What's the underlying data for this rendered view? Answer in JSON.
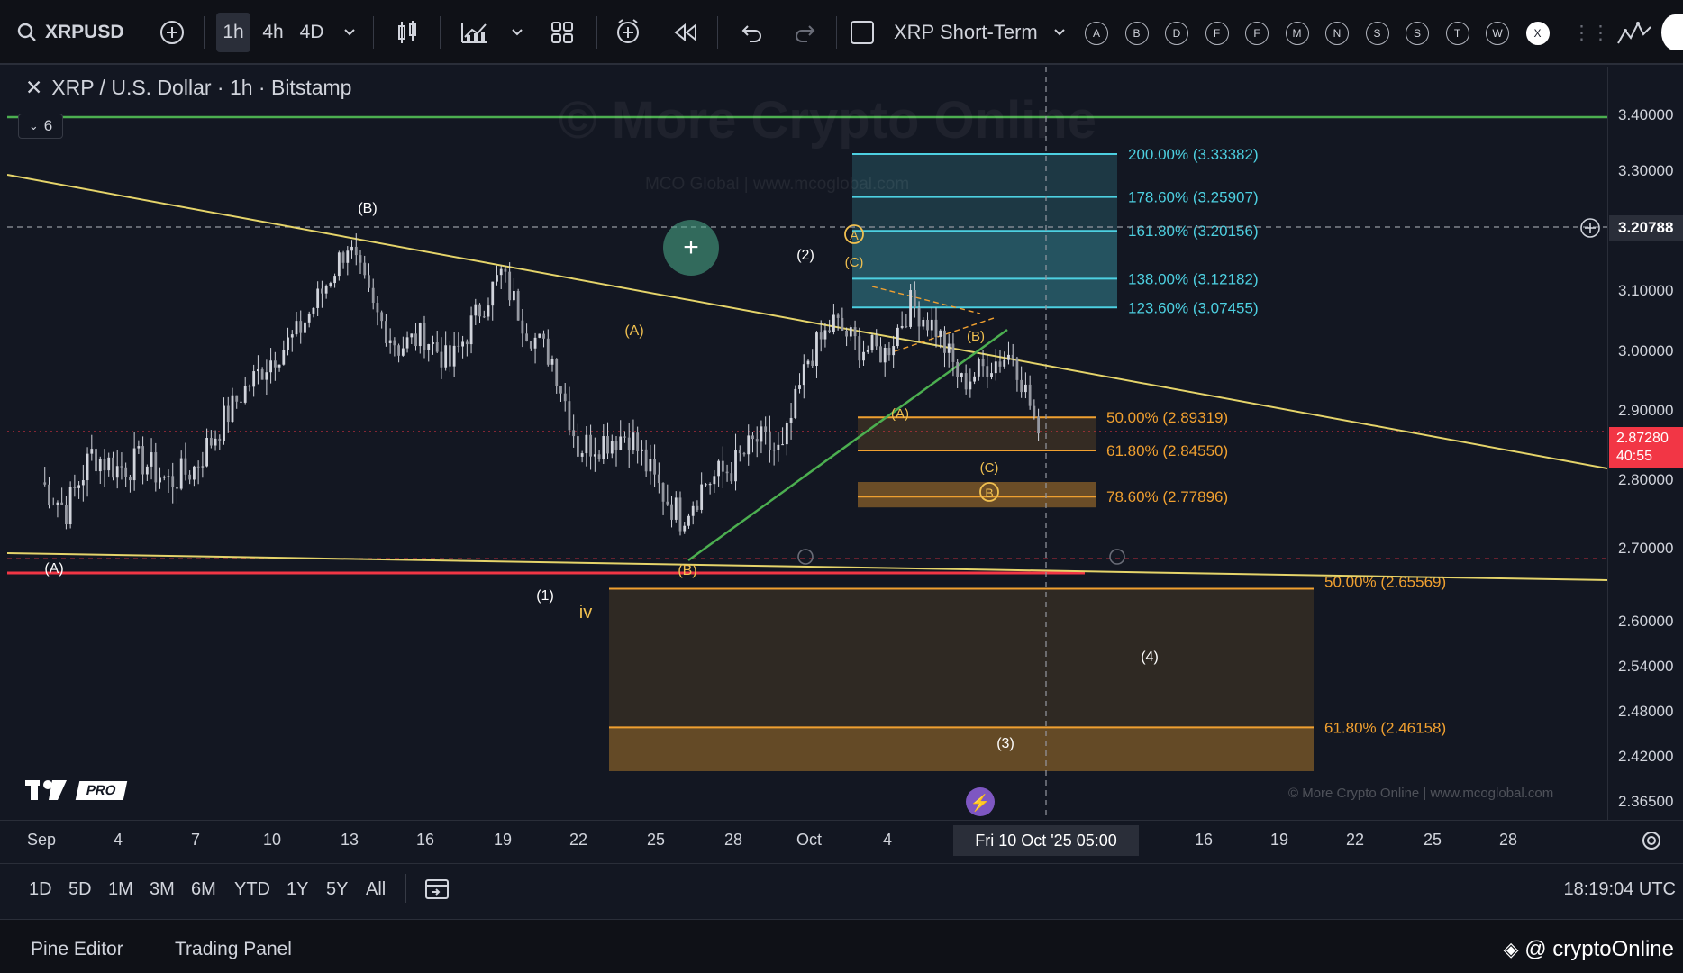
{
  "toolbar": {
    "symbol": "XRPUSD",
    "intervals": [
      "1h",
      "4h",
      "4D"
    ],
    "layout_name": "XRP Short-Term",
    "letter_buttons": [
      "A",
      "B",
      "D",
      "F",
      "F",
      "M",
      "N",
      "S",
      "S",
      "T",
      "W",
      "X"
    ]
  },
  "chart_header": {
    "title": "XRP / U.S. Dollar · 1h · Bitstamp",
    "collapse_count": "6",
    "watermark": "© More Crypto Online",
    "watermark_sub": "MCO Global  |  www.mcoglobal.com",
    "footer_watermark": "© More Crypto Online  |  www.mcoglobal.com",
    "logo_badge": "PRO"
  },
  "price_axis": {
    "ticks": [
      "3.40000",
      "3.30000",
      "3.20788",
      "3.10000",
      "3.00000",
      "2.90000",
      "2.80000",
      "2.70000",
      "2.60000",
      "2.54000",
      "2.48000",
      "2.42000",
      "2.36500"
    ],
    "crosshair_price": "3.20788",
    "last_price": "2.87280",
    "countdown": "40:55"
  },
  "time_axis": {
    "ticks": [
      "Sep",
      "4",
      "7",
      "10",
      "13",
      "16",
      "19",
      "22",
      "25",
      "28",
      "Oct",
      "4",
      "16",
      "19",
      "22",
      "25",
      "28"
    ],
    "cursor_label": "Fri 10 Oct '25   05:00"
  },
  "range_bar": {
    "ranges": [
      "1D",
      "5D",
      "1M",
      "3M",
      "6M",
      "YTD",
      "1Y",
      "5Y",
      "All"
    ],
    "clock": "18:19:04 UTC"
  },
  "bottom_tabs": [
    "Pine Editor",
    "Trading Panel"
  ],
  "credit": "@ cryptoOnline",
  "colors": {
    "bg": "#131722",
    "candle": "#d1d4dc",
    "trend_yellow": "#e5d46a",
    "support_green": "#4caf50",
    "resist_red": "#f23645",
    "fib_blue": "#4dd0e1",
    "fib_orange": "#f0a030"
  },
  "chart_data": {
    "type": "line",
    "series": [
      {
        "x": [
          "Sep 1",
          "Sep 2",
          "Sep 3",
          "Sep 4",
          "Sep 5",
          "Sep 6",
          "Sep 7",
          "Sep 8",
          "Sep 9",
          "Sep 10",
          "Sep 11",
          "Sep 12",
          "Sep 13",
          "Sep 14",
          "Sep 15",
          "Sep 16",
          "Sep 17",
          "Sep 18",
          "Sep 19",
          "Sep 20",
          "Sep 21",
          "Sep 22",
          "Sep 23",
          "Sep 24",
          "Sep 25",
          "Sep 26",
          "Sep 27",
          "Sep 28",
          "Sep 29",
          "Sep 30",
          "Oct 1",
          "Oct 2",
          "Oct 3",
          "Oct 4",
          "Oct 5",
          "Oct 6",
          "Oct 7",
          "Oct 8",
          "Oct 9",
          "Oct 10"
        ],
        "values": [
          2.8,
          2.76,
          2.84,
          2.82,
          2.83,
          2.8,
          2.82,
          2.88,
          2.94,
          2.99,
          3.03,
          3.1,
          3.18,
          3.07,
          3.01,
          3.03,
          2.98,
          3.06,
          3.13,
          3.04,
          2.99,
          2.85,
          2.86,
          2.87,
          2.8,
          2.75,
          2.8,
          2.82,
          2.86,
          2.84,
          2.99,
          3.05,
          3.01,
          3.0,
          3.08,
          3.04,
          2.95,
          2.98,
          3.0,
          2.87
        ]
      }
    ],
    "fib_extensions_up": [
      {
        "label": "200.00% (3.33382)",
        "value": 3.33382
      },
      {
        "label": "178.60% (3.25907)",
        "value": 3.25907
      },
      {
        "label": "161.80% (3.20156)",
        "value": 3.20156
      },
      {
        "label": "138.00% (3.12182)",
        "value": 3.12182
      },
      {
        "label": "123.60% (3.07455)",
        "value": 3.07455
      }
    ],
    "fib_retracements_near": [
      {
        "label": "50.00% (2.89319)",
        "value": 2.89319
      },
      {
        "label": "61.80% (2.84550)",
        "value": 2.8455
      },
      {
        "label": "78.60% (2.77896)",
        "value": 2.77896
      }
    ],
    "fib_retracements_far": [
      {
        "label": "50.00% (2.65569)",
        "value": 2.65569
      },
      {
        "label": "61.80% (2.46158)",
        "value": 2.46158
      }
    ],
    "horizontal_lines": {
      "green": 3.4,
      "red": 2.67,
      "crosshair": 3.20788,
      "last": 2.8728
    },
    "wave_labels": [
      "(B)",
      "(A)",
      "(A)",
      "(B)",
      "(1)",
      "iv",
      "(2)",
      "A",
      "(C)",
      "(B)",
      "(A)",
      "(C)",
      "B",
      "(4)",
      "(3)"
    ],
    "ylim": [
      2.3,
      3.45
    ]
  }
}
